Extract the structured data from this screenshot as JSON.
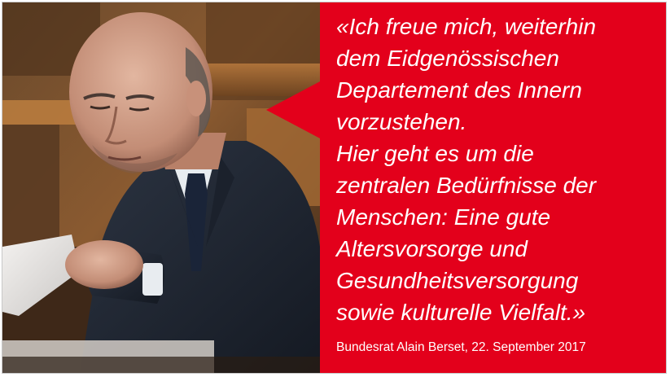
{
  "quote": {
    "text": "«Ich freue mich, weiterhin\ndem Eidgenössischen\nDepartement des Innern\nvorzustehen.\nHier geht es um die\nzentralen Bedürfnisse der\nMenschen: Eine gute\nAltersvorsorge und\nGesundheitsversorgung\nsowie kulturelle Vielfalt.»",
    "attribution": "Bundesrat Alain Berset, 22. September 2017"
  },
  "colors": {
    "panel": "#e3001b",
    "text": "#ffffff"
  },
  "photo": {
    "subject": "man-in-dark-suit-reading-document"
  }
}
